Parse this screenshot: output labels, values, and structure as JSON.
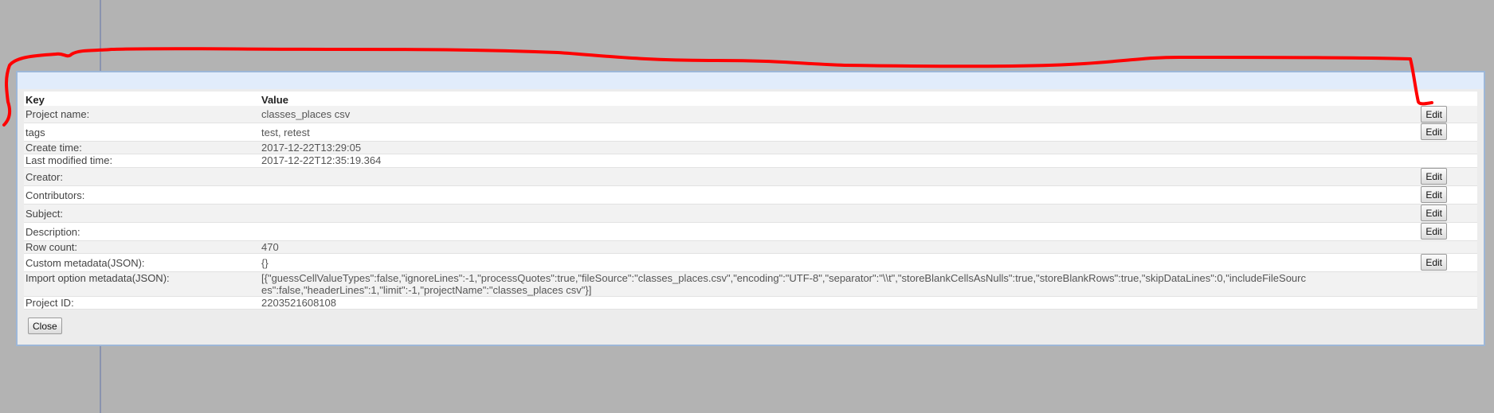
{
  "dialog": {
    "columns": {
      "key": "Key",
      "value": "Value"
    },
    "rows": [
      {
        "key": "Project name:",
        "value": "classes_places csv",
        "action": "Edit"
      },
      {
        "key": "tags",
        "value": "test, retest",
        "action": "Edit"
      },
      {
        "key": "Create time:",
        "value": "2017-12-22T13:29:05",
        "action": ""
      },
      {
        "key": "Last modified time:",
        "value": "2017-12-22T12:35:19.364",
        "action": ""
      },
      {
        "key": "Creator:",
        "value": "",
        "action": "Edit"
      },
      {
        "key": "Contributors:",
        "value": "",
        "action": "Edit"
      },
      {
        "key": "Subject:",
        "value": "",
        "action": "Edit"
      },
      {
        "key": "Description:",
        "value": "",
        "action": "Edit"
      },
      {
        "key": "Row count:",
        "value": "470",
        "action": ""
      },
      {
        "key": "Custom metadata(JSON):",
        "value": "{}",
        "action": "Edit"
      },
      {
        "key": "Import option metadata(JSON):",
        "value": "[{\"guessCellValueTypes\":false,\"ignoreLines\":-1,\"processQuotes\":true,\"fileSource\":\"classes_places.csv\",\"encoding\":\"UTF-8\",\"separator\":\"\\\\t\",\"storeBlankCellsAsNulls\":true,\"storeBlankRows\":true,\"skipDataLines\":0,\"includeFileSources\":false,\"headerLines\":1,\"limit\":-1,\"projectName\":\"classes_places csv\"}]",
        "action": ""
      },
      {
        "key": "Project ID:",
        "value": "2203521608108",
        "action": ""
      }
    ],
    "close_label": "Close"
  },
  "colors": {
    "background": "#b3b3b3",
    "dialog_header": "#e1ecfb",
    "annotation_stroke": "#ff0000"
  }
}
